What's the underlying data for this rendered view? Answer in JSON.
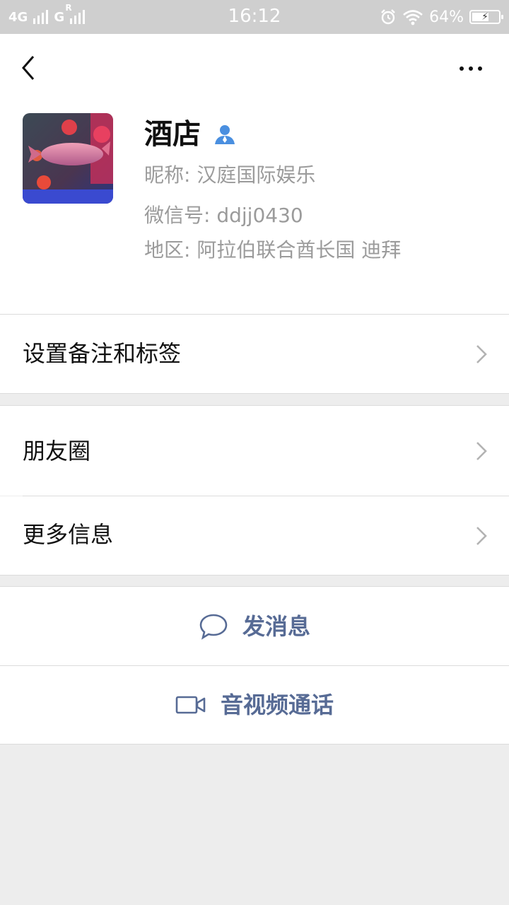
{
  "status_bar": {
    "network_left": "4G",
    "network_right": "G",
    "roaming": "R",
    "time": "16:12",
    "battery_percent": "64%",
    "battery_level": 0.64
  },
  "header": {
    "back_icon": "chevron-left-icon",
    "more_icon": "more-horizontal-icon"
  },
  "profile": {
    "name": "酒店",
    "nickname": "昵称:  汉庭国际娱乐",
    "wechat_id": "微信号:  ddjj0430",
    "region": "地区:  阿拉伯联合酋长国  迪拜",
    "verify_icon": "contact-user-icon"
  },
  "menu": {
    "remark_label": "设置备注和标签",
    "moments_label": "朋友圈",
    "more_info_label": "更多信息"
  },
  "actions": {
    "message_label": "发消息",
    "call_label": "音视频通话"
  },
  "colors": {
    "accent": "#576b95",
    "page_bg": "#ededed",
    "status_bar_bg": "#cfcfcf",
    "secondary_text": "#9b9b9b",
    "verify_blue": "#4a8fe0"
  }
}
